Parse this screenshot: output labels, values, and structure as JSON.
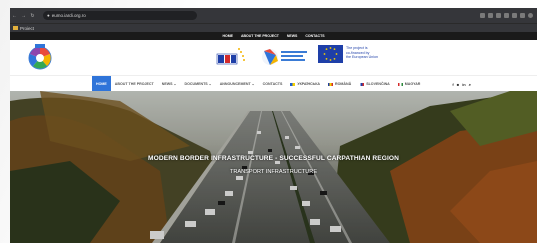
{
  "browser": {
    "url": "eumo.iardi.org.ro",
    "bookmark_label": "Proiect",
    "nav_icons": [
      "back-icon",
      "forward-icon",
      "reload-icon"
    ]
  },
  "topbar": {
    "links": [
      "HOME",
      "ABOUT THE PROJECT",
      "NEWS",
      "CONTACTS"
    ]
  },
  "header": {
    "eu_text": [
      "The project is",
      "co-financed by",
      "the European Union"
    ],
    "prism_text": [
      "Romania",
      "Slovakia",
      "Ukraine"
    ]
  },
  "nav": {
    "items": [
      {
        "label": "HOME",
        "active": true
      },
      {
        "label": "ABOUT THE PROJECT",
        "active": false
      },
      {
        "label": "NEWS ⌄",
        "active": false
      },
      {
        "label": "DOCUMENTS ⌄",
        "active": false
      },
      {
        "label": "ANNOUNCEMENT ⌄",
        "active": false
      },
      {
        "label": "CONTACTS",
        "active": false
      }
    ],
    "languages": [
      {
        "label": "УКРАЇНСЬКА",
        "colors": [
          "#1f5fd1",
          "#f5d000"
        ]
      },
      {
        "label": "ROMÂNĂ",
        "colors": [
          "#1e3fa8",
          "#f5d000",
          "#d42b2b"
        ]
      },
      {
        "label": "SLOVENČINA",
        "colors": [
          "#ffffff",
          "#1e3fa8",
          "#d42b2b"
        ]
      },
      {
        "label": "MAGYAR",
        "colors": [
          "#d42b2b",
          "#ffffff",
          "#2d8a3e"
        ]
      }
    ],
    "social": [
      "f",
      "■",
      "in",
      "⌕"
    ]
  },
  "hero": {
    "title": "MODERN BORDER INFRASTRUCTURE - SUCCESSFUL CARPATHIAN REGION",
    "subtitle": "TRANSPORT INFRASTRUCTURE"
  },
  "colors": {
    "nav_active": "#2f74d9",
    "topbar_bg": "#1a1a1a"
  }
}
